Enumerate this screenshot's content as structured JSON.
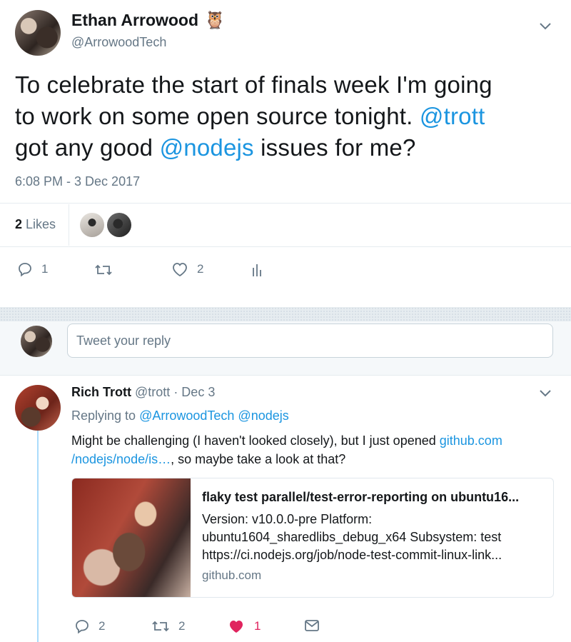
{
  "main_tweet": {
    "author_name": "Ethan Arrowood",
    "author_emoji": "🦉",
    "author_handle": "@ArrowoodTech",
    "text_parts": {
      "t1": "To celebrate the start of finals week I'm going",
      "t2": "to work on some open source tonight. ",
      "mention_trott": "@trott",
      "t3": "got any good ",
      "mention_nodejs": "@nodejs",
      "t4": " issues for me?"
    },
    "timestamp": "6:08 PM - 3 Dec 2017",
    "likes_count": "2",
    "likes_label": "Likes",
    "actions": {
      "reply_count": "1",
      "retweet_count": "",
      "like_count": "2"
    },
    "icons": {
      "reply": "reply-icon",
      "retweet": "retweet-icon",
      "like": "heart-icon",
      "analytics": "analytics-icon",
      "caret": "chevron-down-icon"
    }
  },
  "reply_box": {
    "placeholder": "Tweet your reply"
  },
  "reply_tweet": {
    "author_name": "Rich Trott",
    "author_handle": "@trott",
    "date": "· Dec 3",
    "replying_prefix": "Replying to ",
    "replying_to_1": "@ArrowoodTech",
    "replying_to_2": "@nodejs",
    "text_line1_a": "Might be challenging (I haven't looked closely), but I just opened ",
    "link_part1": "github.com",
    "link_part2": "/nodejs/node/is…",
    "text_line2_b": ", so maybe take a look at that?",
    "card": {
      "title": "flaky test parallel/test-error-reporting on ubuntu16...",
      "desc_line1": "Version: v10.0.0-pre Platform:",
      "desc_line2": "ubuntu1604_sharedlibs_debug_x64 Subsystem: test",
      "desc_line3": "https://ci.nodejs.org/job/node-test-commit-linux-link...",
      "domain": "github.com"
    },
    "actions": {
      "reply_count": "2",
      "retweet_count": "2",
      "like_count": "1"
    },
    "like_color": "#e0245e"
  },
  "colors": {
    "link": "#1b95e0",
    "muted": "#657786",
    "thread_line": "#aadcfc"
  }
}
